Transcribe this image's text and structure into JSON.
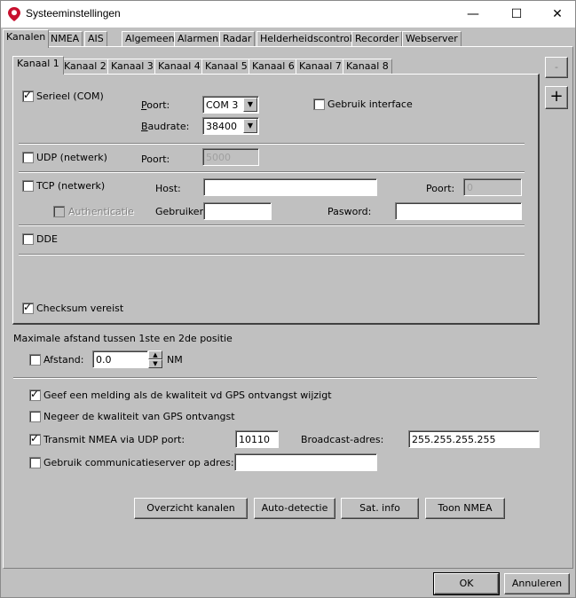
{
  "window": {
    "title": "Systeeminstellingen",
    "minimize": "—",
    "maximize": "☐",
    "close": "✕"
  },
  "main_tabs": [
    "Kanalen",
    "NMEA",
    "AIS",
    "Algemeen",
    "Alarmen",
    "Radar",
    "Helderheidscontrole",
    "Recorder",
    "Webserver"
  ],
  "channel_tabs": [
    "Kanaal 1",
    "Kanaal 2",
    "Kanaal 3",
    "Kanaal 4",
    "Kanaal 5",
    "Kanaal 6",
    "Kanaal 7",
    "Kanaal 8"
  ],
  "side_buttons": {
    "remove": "-",
    "add": "+"
  },
  "serial": {
    "label": "Serieel (COM)",
    "checked": true,
    "port_label": "Poort:",
    "port_value": "COM 3",
    "baud_label": "Baudrate:",
    "baud_value": "38400",
    "interface_label": "Gebruik interface"
  },
  "udp": {
    "label": "UDP (netwerk)",
    "port_label": "Poort:",
    "port_value": "5000"
  },
  "tcp": {
    "label": "TCP (netwerk)",
    "host_label": "Host:",
    "host_value": "",
    "port_label": "Poort:",
    "port_value": "0",
    "auth_label": "Authenticatie",
    "user_label": "Gebruiker:",
    "user_value": "",
    "password_label": "Pasword:",
    "password_value": ""
  },
  "dde": {
    "label": "DDE"
  },
  "checksum": {
    "label": "Checksum vereist",
    "checked": true
  },
  "distance": {
    "heading": "Maximale afstand tussen 1ste en 2de positie",
    "label": "Afstand:",
    "value": "0.0",
    "unit": "NM"
  },
  "options": {
    "gps_quality_notify": "Geef een melding als de kwaliteit vd GPS ontvangst wijzigt",
    "ignore_gps_quality": "Negeer de kwaliteit van GPS ontvangst",
    "transmit_nmea": "Transmit NMEA via UDP port:",
    "transmit_port": "10110",
    "broadcast_label": "Broadcast-adres:",
    "broadcast_value": "255.255.255.255",
    "comm_server": "Gebruik communicatieserver op adres:",
    "comm_server_value": ""
  },
  "action_buttons": {
    "overview": "Overzicht kanalen",
    "autodetect": "Auto-detectie",
    "satinfo": "Sat. info",
    "shownmea": "Toon NMEA"
  },
  "footer": {
    "ok": "OK",
    "cancel": "Annuleren"
  }
}
